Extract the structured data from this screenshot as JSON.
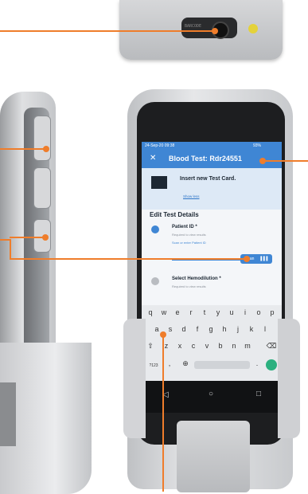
{
  "screen": {
    "status": {
      "date": "24-Sep-20 09:38",
      "battery": "93%"
    },
    "appbar": {
      "close_icon": "close-icon",
      "title": "Blood Test: Rdr24551"
    },
    "banner": {
      "icon": "test-card-icon",
      "title": "Insert new Test Card.",
      "link": "Show less"
    },
    "section_title": "Edit Test Details",
    "steps": [
      {
        "title": "Patient ID *",
        "subtitle": "Required to view results",
        "hint": "Scan or enter Patient ID",
        "state": "active"
      },
      {
        "title": "Select Hemodilution *",
        "subtitle": "Required to view results",
        "state": "pending"
      }
    ],
    "scan_button": "Scan",
    "keyboard": {
      "row1": [
        "q",
        "w",
        "e",
        "r",
        "t",
        "y",
        "u",
        "i",
        "o",
        "p"
      ],
      "row2": [
        "a",
        "s",
        "d",
        "f",
        "g",
        "h",
        "j",
        "k",
        "l"
      ],
      "row3": [
        "z",
        "x",
        "c",
        "v",
        "b",
        "n",
        "m"
      ],
      "row4_left": "?123"
    },
    "nav": {
      "back": "◁",
      "home": "○",
      "recent": "□"
    }
  },
  "colors": {
    "accent": "#3f86d4",
    "callout": "#ef7d2b"
  }
}
